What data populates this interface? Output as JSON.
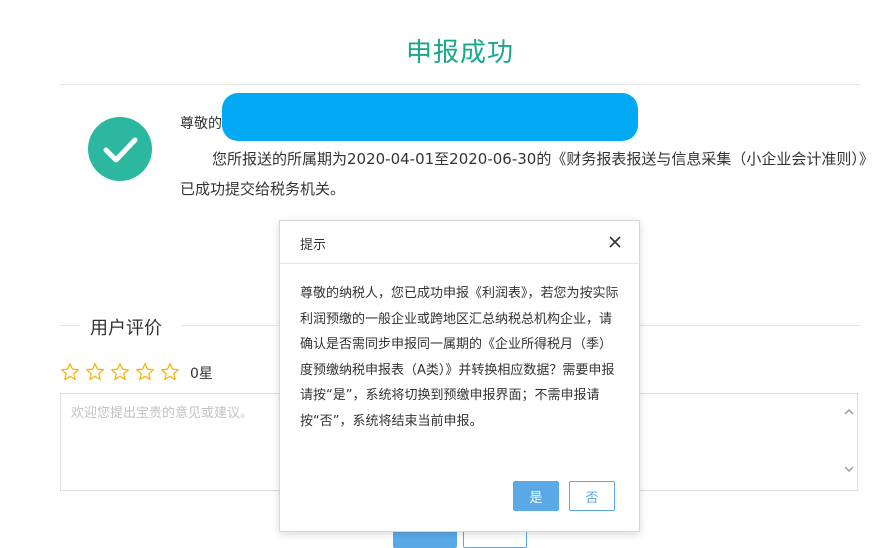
{
  "page": {
    "title": "申报成功",
    "greeting": "尊敬的",
    "message": "您所报送的所属期为2020-04-01至2020-06-30的《财务报表报送与信息采集（小企业会计准则）》已成功提交给税务机关。"
  },
  "evaluation": {
    "section_title": "用户评价",
    "rating": 0,
    "max_rating": 5,
    "rating_text": "0星",
    "comment_placeholder": "欢迎您提出宝贵的意见或建议。",
    "comment_value": ""
  },
  "dialog": {
    "title": "提示",
    "body": "尊敬的纳税人，您已成功申报《利润表》，若您为按实际利润预缴的一般企业或跨地区汇总纳税总机构企业，请确认是否需同步申报同一属期的《企业所得税月（季）度预缴纳税申报表（A类）》并转换相应数据？需要申报请按“是”，系统将切换到预缴申报界面；不需申报请按“否”，系统将结束当前申报。",
    "yes_label": "是",
    "no_label": "否"
  },
  "colors": {
    "title_green": "#1aa88a",
    "success_icon": "#2bb7a0",
    "redaction": "#03a9f4",
    "primary_button": "#5aa9e6",
    "star_outline": "#f5b400"
  },
  "icons": {
    "success": "check-circle-icon",
    "star": "star-outline-icon",
    "close": "close-icon"
  }
}
